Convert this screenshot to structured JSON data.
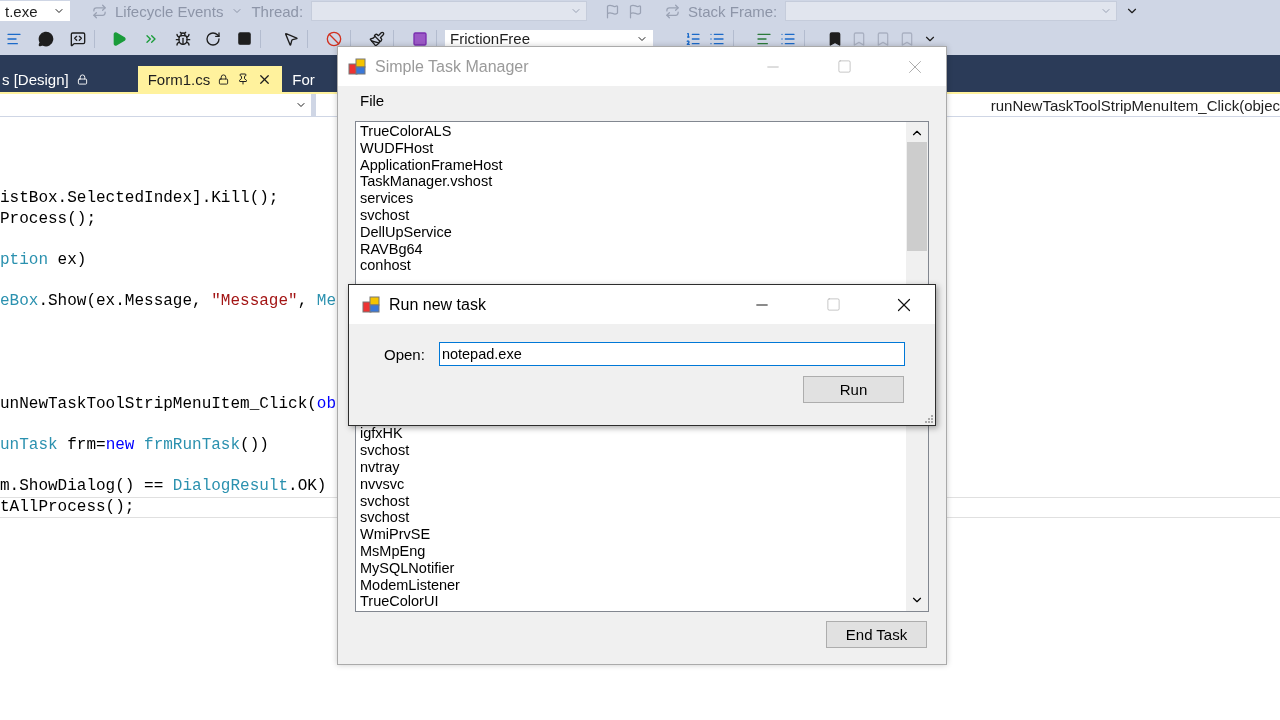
{
  "ide": {
    "toolbar_top": {
      "startup_item": "t.exe",
      "lifecycle_events": "Lifecycle Events",
      "thread_label": "Thread:",
      "stack_frame_label": "Stack Frame:"
    },
    "toolbar_main": {
      "solution_config": "FrictionFree"
    },
    "tabs": [
      {
        "label": "s [Design]",
        "selected": false
      },
      {
        "label": "Form1.cs",
        "selected": true
      },
      {
        "label": "For",
        "selected": false
      }
    ],
    "navigation": {
      "member": "runNewTaskToolStripMenuItem_Click(objec"
    },
    "code_lines": [
      {
        "current": false,
        "tokens": [
          {
            "kind": "plain",
            "text": "istBox.SelectedIndex].Kill();"
          }
        ]
      },
      {
        "current": false,
        "tokens": [
          {
            "kind": "plain",
            "text": "Process();"
          }
        ]
      },
      {
        "current": false,
        "tokens": [
          {
            "kind": "type",
            "text": "ption"
          },
          {
            "kind": "plain",
            "text": " ex)"
          }
        ]
      },
      {
        "current": false,
        "tokens": [
          {
            "kind": "type",
            "text": "eBox"
          },
          {
            "kind": "plain",
            "text": ".Show(ex.Message, "
          },
          {
            "kind": "string",
            "text": "\"Message\""
          },
          {
            "kind": "plain",
            "text": ", "
          },
          {
            "kind": "type",
            "text": "Me"
          }
        ]
      },
      {
        "current": false,
        "tokens": [
          {
            "kind": "plain",
            "text": "unNewTaskToolStripMenuItem_Click("
          },
          {
            "kind": "keyword",
            "text": "ob"
          }
        ]
      },
      {
        "current": false,
        "tokens": [
          {
            "kind": "type",
            "text": "unTask"
          },
          {
            "kind": "plain",
            "text": " frm="
          },
          {
            "kind": "keyword",
            "text": "new"
          },
          {
            "kind": "type",
            "text": " frmRunTask"
          },
          {
            "kind": "plain",
            "text": "())"
          }
        ]
      },
      {
        "current": false,
        "tokens": [
          {
            "kind": "plain",
            "text": "m.ShowDialog() == "
          },
          {
            "kind": "type",
            "text": "DialogResult"
          },
          {
            "kind": "plain",
            "text": ".OK)"
          }
        ]
      },
      {
        "current": true,
        "tokens": [
          {
            "kind": "plain",
            "text": "tAllProcess();"
          }
        ]
      }
    ]
  },
  "task_manager": {
    "title": "Simple Task Manager",
    "active": false,
    "menu": [
      "File"
    ],
    "processes_above": [
      "TrueColorALS",
      "WUDFHost",
      "ApplicationFrameHost",
      "TaskManager.vshost",
      "services",
      "svchost",
      "DellUpService",
      "RAVBg64",
      "conhost"
    ],
    "processes_below": [
      "igfxHK",
      "svchost",
      "nvtray",
      "nvvsvc",
      "svchost",
      "svchost",
      "WmiPrvSE",
      "MsMpEng",
      "MySQLNotifier",
      "ModemListener",
      "TrueColorUI"
    ],
    "end_task_button": "End Task"
  },
  "run_dialog": {
    "title": "Run new task",
    "active": true,
    "open_label": "Open:",
    "open_value": "notepad.exe",
    "run_button": "Run"
  }
}
